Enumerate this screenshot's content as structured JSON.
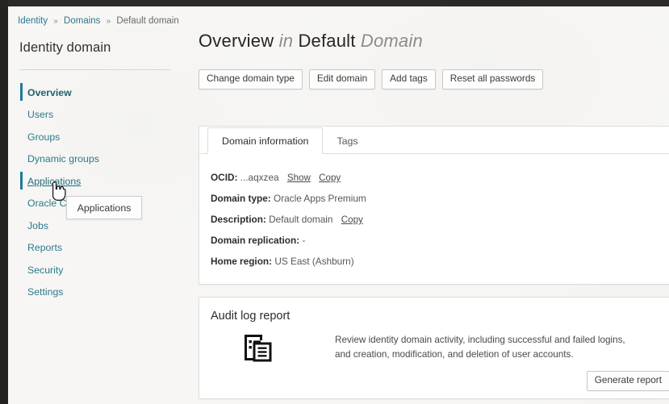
{
  "breadcrumb": {
    "items": [
      {
        "label": "Identity",
        "type": "link"
      },
      {
        "label": "Domains",
        "type": "link"
      },
      {
        "label": "Default domain",
        "type": "current"
      }
    ],
    "separator": "»"
  },
  "sidebar": {
    "title": "Identity domain",
    "items": [
      {
        "label": "Overview",
        "state": "active"
      },
      {
        "label": "Users",
        "state": "normal"
      },
      {
        "label": "Groups",
        "state": "normal"
      },
      {
        "label": "Dynamic groups",
        "state": "normal"
      },
      {
        "label": "Applications",
        "state": "hovered"
      },
      {
        "label": "Oracle C",
        "state": "normal"
      },
      {
        "label": "Jobs",
        "state": "normal"
      },
      {
        "label": "Reports",
        "state": "normal"
      },
      {
        "label": "Security",
        "state": "normal"
      },
      {
        "label": "Settings",
        "state": "normal"
      }
    ]
  },
  "tooltip": {
    "text": "Applications"
  },
  "header": {
    "title_part1": "Overview",
    "title_in": "in",
    "title_part2": "Default",
    "title_part3": "Domain"
  },
  "toolbar": {
    "buttons": [
      {
        "label": "Change domain type"
      },
      {
        "label": "Edit domain"
      },
      {
        "label": "Add tags"
      },
      {
        "label": "Reset all passwords"
      }
    ]
  },
  "domain_card": {
    "tabs": [
      {
        "label": "Domain information",
        "active": true
      },
      {
        "label": "Tags",
        "active": false
      }
    ],
    "fields": [
      {
        "label": "OCID:",
        "value": "...aqxzea",
        "links": [
          "Show",
          "Copy"
        ]
      },
      {
        "label": "Domain type:",
        "value": "Oracle Apps Premium",
        "links": []
      },
      {
        "label": "Description:",
        "value": "Default domain",
        "links": [
          "Copy"
        ]
      },
      {
        "label": "Domain replication:",
        "value": "-",
        "links": []
      },
      {
        "label": "Home region:",
        "value": "US East (Ashburn)",
        "links": []
      }
    ]
  },
  "audit_card": {
    "title": "Audit log report",
    "icon": "report-document-icon",
    "description": "Review identity domain activity, including successful and failed logins, and creation, modification, and deletion of user accounts.",
    "button_label": "Generate report"
  },
  "colors": {
    "accent": "#1d7a99",
    "link": "#2a7a8c",
    "chrome": "#2b2a28",
    "page_bg": "#f7f6f4",
    "card_bg": "#ffffff"
  }
}
